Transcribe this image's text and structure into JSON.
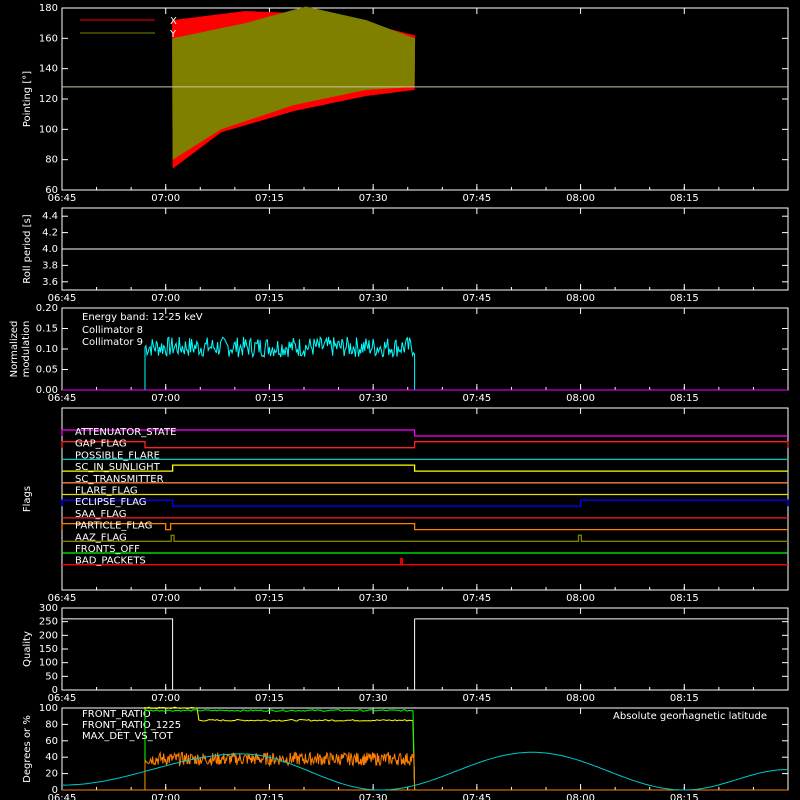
{
  "time_ticks": [
    "06:45",
    "07:00",
    "07:15",
    "07:30",
    "07:45",
    "08:00",
    "08:15"
  ],
  "chart_data": [
    {
      "id": "pointing",
      "type": "line",
      "ylabel": "Pointing [°]",
      "ylim": [
        60,
        180
      ],
      "yticks": [
        60,
        80,
        100,
        120,
        140,
        160,
        180
      ],
      "legend_position": "top-left",
      "series": [
        {
          "name": "X",
          "color": "#ff0000",
          "t_range": [
            "07:01",
            "07:36"
          ],
          "upper": [
            [
              0,
              172
            ],
            [
              0.3,
              178
            ],
            [
              0.6,
              176
            ],
            [
              0.8,
              170
            ],
            [
              1,
              162
            ]
          ],
          "lower": [
            [
              0,
              74
            ],
            [
              0.2,
              98
            ],
            [
              0.5,
              112
            ],
            [
              0.8,
              122
            ],
            [
              1,
              126
            ]
          ]
        },
        {
          "name": "Y",
          "color": "#808000",
          "t_range": [
            "07:01",
            "07:36"
          ],
          "upper": [
            [
              0,
              160
            ],
            [
              0.3,
              170
            ],
            [
              0.55,
              181
            ],
            [
              0.8,
              172
            ],
            [
              1,
              160
            ]
          ],
          "lower": [
            [
              0,
              80
            ],
            [
              0.2,
              100
            ],
            [
              0.5,
              116
            ],
            [
              0.8,
              126
            ],
            [
              1,
              128
            ]
          ]
        }
      ],
      "reference_line": {
        "value": 128,
        "color": "#c8c8a0"
      }
    },
    {
      "id": "roll",
      "type": "line",
      "ylabel": "Roll period [s]",
      "ylim": [
        3.5,
        4.5
      ],
      "yticks": [
        3.6,
        3.8,
        4.0,
        4.2,
        4.4
      ],
      "series": [
        {
          "name": "",
          "color": "#ffffff",
          "constant": 4.0
        }
      ]
    },
    {
      "id": "modulation",
      "type": "line",
      "ylabel_lines": [
        "Normalized",
        "modulation"
      ],
      "ylim": [
        0,
        0.2
      ],
      "yticks": [
        0.0,
        0.05,
        0.1,
        0.15,
        0.2
      ],
      "annotation": "Energy band: 12-25 keV",
      "legend_position": "top-left",
      "series": [
        {
          "name": "Collimator 8",
          "color": "#00ffff",
          "t_range": [
            "06:57",
            "07:36"
          ],
          "mean": 0.105,
          "spread": 0.025
        },
        {
          "name": "Collimator 9",
          "color": "#ff00ff",
          "constant": 0.0
        }
      ]
    },
    {
      "id": "flags",
      "type": "line",
      "ylabel": "Flags",
      "series": [
        {
          "name": "ATTENUATOR_STATE",
          "color": "#ff00ff",
          "high": [
            [
              "06:45",
              "07:36"
            ]
          ]
        },
        {
          "name": "GAP_FLAG",
          "color": "#ff2020",
          "high": [
            [
              "06:45",
              "06:57"
            ],
            [
              "07:36",
              "08:30"
            ]
          ]
        },
        {
          "name": "POSSIBLE_FLARE",
          "color": "#00c8c8",
          "high": []
        },
        {
          "name": "SC_IN_SUNLIGHT",
          "color": "#ffff00",
          "high": [
            [
              "07:01",
              "07:36"
            ]
          ]
        },
        {
          "name": "SC_TRANSMITTER",
          "color": "#ff8040",
          "high": []
        },
        {
          "name": "FLARE_FLAG",
          "color": "#e0e000",
          "high": []
        },
        {
          "name": "ECLIPSE_FLAG",
          "color": "#0000ff",
          "high": [
            [
              "06:45",
              "07:01"
            ],
            [
              "08:00",
              "08:30"
            ]
          ]
        },
        {
          "name": "SAA_FLAG",
          "color": "#ff2020",
          "high": []
        },
        {
          "name": "PARTICLE_FLAG",
          "color": "#ff8000",
          "high": [
            [
              "06:45",
              "07:00"
            ],
            [
              "07:00.7",
              "07:36"
            ]
          ]
        },
        {
          "name": "AAZ_FLAG",
          "color": "#808000",
          "high": [
            [
              "07:00.8",
              "07:01.2"
            ],
            [
              "07:59.7",
              "08:00.1"
            ]
          ]
        },
        {
          "name": "FRONTS_OFF",
          "color": "#00ff00",
          "high": []
        },
        {
          "name": "BAD_PACKETS",
          "color": "#ff0000",
          "high": [
            [
              "07:34",
              "07:34.2"
            ]
          ]
        }
      ]
    },
    {
      "id": "quality",
      "type": "line",
      "ylabel": "Quality",
      "ylim": [
        0,
        300
      ],
      "yticks": [
        0,
        50,
        100,
        150,
        200,
        250,
        300
      ],
      "series": [
        {
          "name": "",
          "color": "#ffffff",
          "high": [
            [
              "06:45",
              "07:01"
            ],
            [
              "07:36",
              "08:30"
            ]
          ],
          "high_value": 260,
          "low_value": 0
        }
      ]
    },
    {
      "id": "ratios",
      "type": "line",
      "ylabel": "Degrees or %",
      "ylim": [
        0,
        100
      ],
      "yticks": [
        0,
        20,
        40,
        60,
        80,
        100
      ],
      "legend_position": "top-left",
      "series": [
        {
          "name": "FRONT_RATIO",
          "color": "#ffff00",
          "t_range": [
            "06:57",
            "07:36"
          ],
          "segments": [
            [
              0,
              0.2,
              100
            ],
            [
              0.2,
              1,
              85
            ]
          ]
        },
        {
          "name": "FRONT_RATIO_1225",
          "color": "#00ff00",
          "t_range": [
            "06:57",
            "07:36"
          ],
          "segments": [
            [
              0,
              1,
              97
            ]
          ]
        },
        {
          "name": "MAX_DET_VS_TOT",
          "color": "#ff8000",
          "t_range": [
            "06:57",
            "07:36"
          ],
          "mean": 38,
          "spread": 8
        },
        {
          "name": "Absolute geomagnetic latitude",
          "color": "#00c8c8",
          "points": [
            [
              "06:45",
              6
            ],
            [
              "07:11",
              44
            ],
            [
              "07:31",
              0
            ],
            [
              "07:53",
              46
            ],
            [
              "08:15",
              0
            ],
            [
              "08:30",
              25
            ]
          ]
        }
      ],
      "right_label": "Absolute geomagnetic latitude"
    }
  ],
  "colors": {
    "background": "#000000",
    "axes": "#ffffff"
  }
}
